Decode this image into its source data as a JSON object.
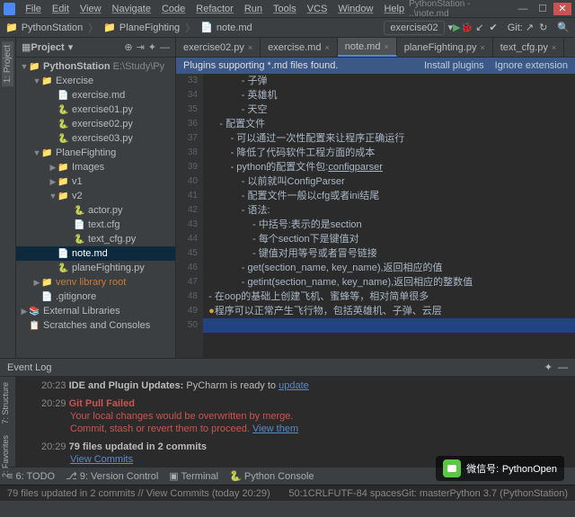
{
  "title": "PythonStation - ..\\note.md",
  "menus": [
    "File",
    "Edit",
    "View",
    "Navigate",
    "Code",
    "Refactor",
    "Run",
    "Tools",
    "VCS",
    "Window",
    "Help"
  ],
  "breadcrumb": {
    "root": "PythonStation",
    "folder": "PlaneFighting",
    "file": "note.md"
  },
  "run_config": "exercise02",
  "git_label": "Git:",
  "project_header": "Project",
  "project_root": {
    "name": "PythonStation",
    "path": "E:\\Study\\Py"
  },
  "tree": {
    "exercise": "Exercise",
    "ex_md": "exercise.md",
    "ex01": "exercise01.py",
    "ex02": "exercise02.py",
    "ex03": "exercise03.py",
    "plane": "PlaneFighting",
    "images": "Images",
    "v1": "v1",
    "v2": "v2",
    "actor": "actor.py",
    "textcfg": "text.cfg",
    "textcfgpy": "text_cfg.py",
    "note": "note.md",
    "planepy": "planeFighting.py",
    "venv": "venv",
    "venv_lib": "library root",
    "gitignore": ".gitignore",
    "extlib": "External Libraries",
    "scratch": "Scratches and Consoles"
  },
  "tabs": [
    {
      "label": "exercise02.py"
    },
    {
      "label": "exercise.md"
    },
    {
      "label": "note.md"
    },
    {
      "label": "planeFighting.py"
    },
    {
      "label": "text_cfg.py"
    }
  ],
  "banner": {
    "msg": "Plugins supporting *.md files found.",
    "install": "Install plugins",
    "ignore": "Ignore extension"
  },
  "lines": {
    "start": 33,
    "l33": "- 子弹",
    "l34": "- 英雄机",
    "l35": "- 天空",
    "l36": "- 配置文件",
    "l37": "- 可以通过一次性配置来让程序正确运行",
    "l38": "- 降低了代码软件工程方面的成本",
    "l39a": "- python的配置文件包:",
    "l39b": "configparser",
    "l40": "- 以前就叫ConfigParser",
    "l41": "- 配置文件一般以cfg或者ini结尾",
    "l42": "- 语法:",
    "l43": "- 中括号:表示的是section",
    "l44": "- 每个section下是键值对",
    "l45": "- 键值对用等号或者冒号链接",
    "l46": "- get(section_name, key_name),返回相应的值",
    "l47": "- getint(section_name, key_name),返回相应的整数值",
    "l48": "- 在oop的基础上创建飞机、蜜蜂等，相对简单很多",
    "l49": "程序可以正常产生飞行物，包括英雄机、子弹、云层"
  },
  "eventlog": {
    "header": "Event Log",
    "r1_time": "20:23",
    "r1_msg": "IDE and Plugin Updates:",
    "r1_tail": "PyCharm is ready to",
    "r1_link": "update",
    "r2_time": "20:29",
    "r2_msg": "Git Pull Failed",
    "r2_l2": "Your local changes would be overwritten by merge.",
    "r2_l3a": "Commit, stash or revert them to proceed.",
    "r2_l3b": "View them",
    "r3_time": "20:29",
    "r3_msg": "79 files updated in 2 commits",
    "r3_link": "View Commits"
  },
  "side_tabs": {
    "project": "1: Project",
    "structure": "7: Structure",
    "favorites": "2: Favorites"
  },
  "status": {
    "todo": "6: TODO",
    "vc": "9: Version Control",
    "terminal": "Terminal",
    "pyconsole": "Python Console"
  },
  "status2": {
    "pos": "50:1",
    "enc": "CRLF",
    "utf": "UTF-8",
    "spaces": "4 spaces",
    "branch": "Git: master",
    "python": "Python 3.7 (PythonStation)"
  },
  "wx": {
    "label": "微信号:",
    "value": "PythonOpen"
  }
}
